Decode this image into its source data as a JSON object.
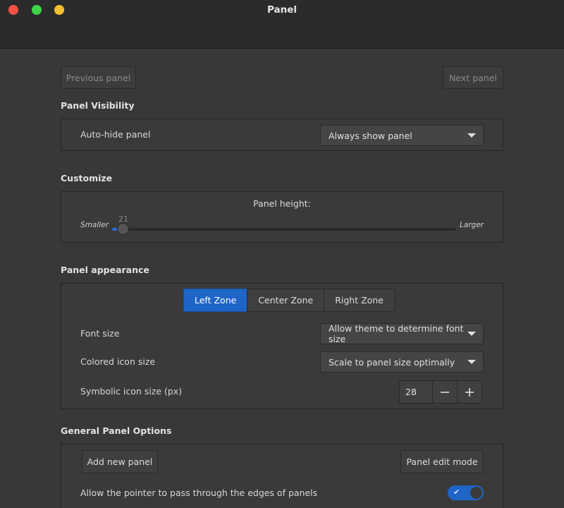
{
  "window": {
    "title": "Panel"
  },
  "nav": {
    "previous_label": "Previous panel",
    "next_label": "Next panel"
  },
  "visibility": {
    "title": "Panel Visibility",
    "autohide_label": "Auto-hide panel",
    "autohide_value": "Always show panel"
  },
  "customize": {
    "title": "Customize",
    "height_label": "Panel height:",
    "smaller_label": "Smaller",
    "larger_label": "Larger",
    "height_value": "21",
    "height_fraction": 0.03
  },
  "appearance": {
    "title": "Panel appearance",
    "zones": [
      {
        "label": "Left Zone",
        "active": true
      },
      {
        "label": "Center Zone",
        "active": false
      },
      {
        "label": "Right Zone",
        "active": false
      }
    ],
    "font_size_label": "Font size",
    "font_size_value": "Allow theme to determine font size",
    "colored_icon_label": "Colored icon size",
    "colored_icon_value": "Scale to panel size optimally",
    "symbolic_icon_label": "Symbolic icon size (px)",
    "symbolic_icon_value": "28"
  },
  "general": {
    "title": "General Panel Options",
    "add_label": "Add new panel",
    "edit_mode_label": "Panel edit mode",
    "pointer_label": "Allow the pointer to pass through the edges of panels",
    "pointer_enabled": true
  },
  "colors": {
    "accent": "#1f65c8",
    "background": "#383838"
  }
}
